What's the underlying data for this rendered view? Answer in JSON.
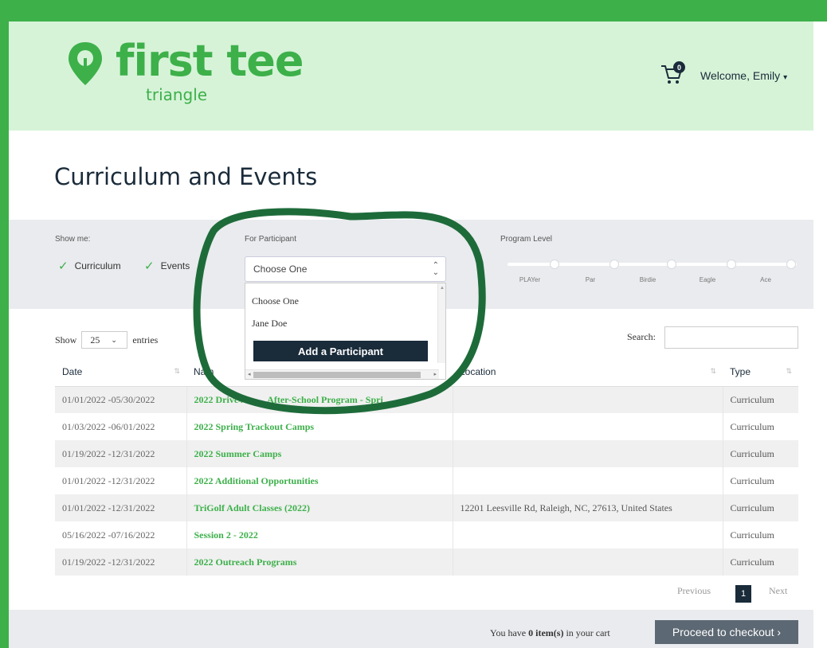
{
  "brand": {
    "name": "first tee",
    "sub": "triangle",
    "accent": "#3db04a",
    "dark": "#1a2b3a"
  },
  "header": {
    "cart_count": "0",
    "welcome": "Welcome, Emily",
    "cart_icon": "shopping-cart-icon"
  },
  "page_title": "Curriculum and Events",
  "filters": {
    "show_me_label": "Show me:",
    "curriculum_label": "Curriculum",
    "events_label": "Events",
    "participant_label": "For Participant",
    "participant_value": "Choose One",
    "program_level_label": "Program Level",
    "levels": [
      "PLAYer",
      "Par",
      "Birdie",
      "Eagle",
      "Ace"
    ]
  },
  "dropdown": {
    "options": [
      "Choose One",
      "Jane Doe"
    ],
    "add_button": "Add a Participant"
  },
  "table_controls": {
    "show_label": "Show",
    "entries_value": "25",
    "entries_label": "entries",
    "search_label": "Search:"
  },
  "table": {
    "headers": {
      "date": "Date",
      "name": "Nam",
      "location": "Location",
      "type": "Type"
    },
    "rows": [
      {
        "date": "01/01/2022 -05/30/2022",
        "name": "2022 Drive4",
        "name2": "After-School Program - Spri",
        "location": "",
        "type": "Curriculum"
      },
      {
        "date": "01/03/2022 -06/01/2022",
        "name": "2022 Spring Trackout Camps",
        "location": "",
        "type": "Curriculum"
      },
      {
        "date": "01/19/2022 -12/31/2022",
        "name": "2022 Summer Camps",
        "location": "",
        "type": "Curriculum"
      },
      {
        "date": "01/01/2022 -12/31/2022",
        "name": "2022 Additional Opportunities",
        "location": "",
        "type": "Curriculum"
      },
      {
        "date": "01/01/2022 -12/31/2022",
        "name": "TriGolf Adult Classes (2022)",
        "location": "12201 Leesville Rd, Raleigh, NC, 27613, United States",
        "type": "Curriculum"
      },
      {
        "date": "05/16/2022 -07/16/2022",
        "name": "Session 2 - 2022",
        "location": "",
        "type": "Curriculum"
      },
      {
        "date": "01/19/2022 -12/31/2022",
        "name": "2022 Outreach Programs",
        "location": "",
        "type": "Curriculum"
      }
    ]
  },
  "pagination": {
    "previous": "Previous",
    "current": "1",
    "next": "Next"
  },
  "footer": {
    "cart_prefix": "You have",
    "cart_items": "0 item(s)",
    "cart_suffix": "in your cart",
    "checkout": "Proceed to checkout ›"
  }
}
